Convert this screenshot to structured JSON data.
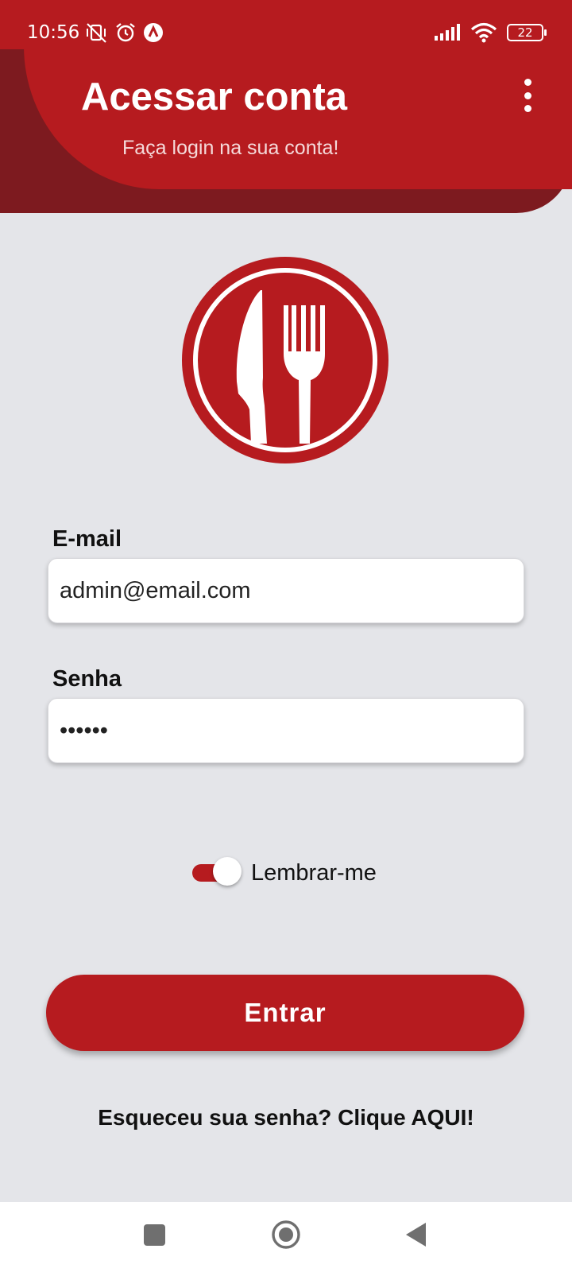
{
  "status_bar": {
    "time": "10:56",
    "battery": "22",
    "icons_left": [
      "vibrate-off-icon",
      "alarm-icon",
      "app-notification-icon"
    ],
    "icons_right": [
      "signal-icon",
      "wifi-icon",
      "battery-icon"
    ]
  },
  "header": {
    "title": "Acessar conta",
    "subtitle": "Faça login na sua conta!",
    "menu_icon": "more-vert-icon"
  },
  "logo": {
    "icon": "knife-fork-plate-logo"
  },
  "form": {
    "email_label": "E-mail",
    "email_value": "admin@email.com",
    "password_label": "Senha",
    "password_value": "••••••",
    "remember_label": "Lembrar-me",
    "remember_on": true,
    "submit_label": "Entrar",
    "forgot_text": "Esqueceu sua senha? Clique AQUI!"
  },
  "nav_bar": {
    "icons": [
      "recent-apps-icon",
      "home-icon",
      "back-icon"
    ]
  },
  "colors": {
    "primary": "#b61b1f",
    "primary_dark": "#7d1a1f",
    "background": "#e4e5e9"
  }
}
